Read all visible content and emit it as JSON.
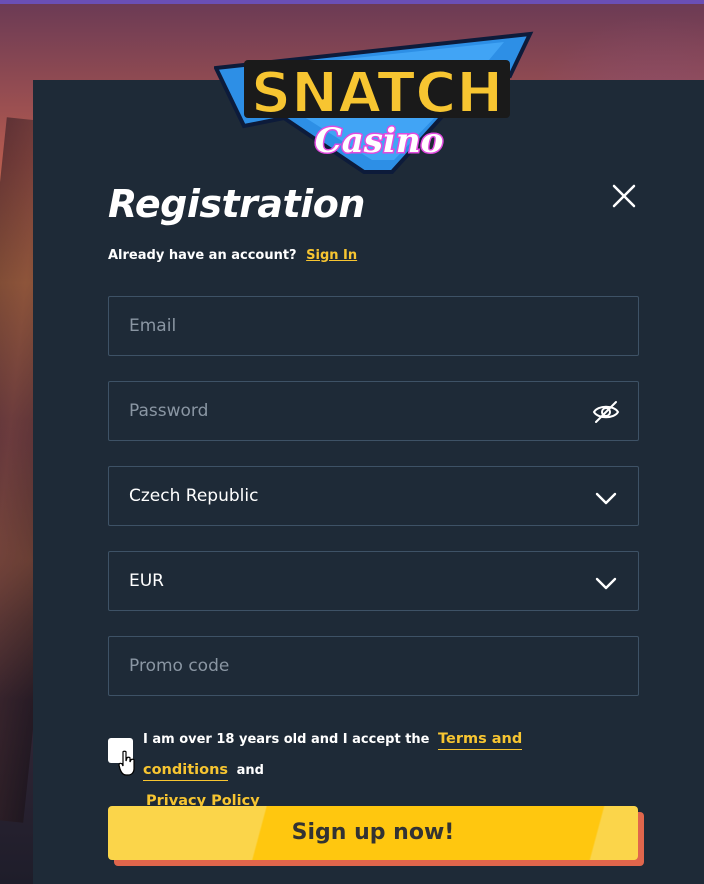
{
  "brand": {
    "logo_text_main": "SNATCH",
    "logo_text_sub": "Casino"
  },
  "modal": {
    "title": "Registration",
    "signin_prompt": "Already have an account?",
    "signin_link": "Sign In"
  },
  "form": {
    "email": {
      "placeholder": "Email",
      "value": ""
    },
    "password": {
      "placeholder": "Password",
      "value": ""
    },
    "country": {
      "selected": "Czech Republic"
    },
    "currency": {
      "selected": "EUR"
    },
    "promo": {
      "placeholder": "Promo code",
      "value": ""
    },
    "terms": {
      "prefix": "I am over 18 years old and I accept the",
      "terms_link": "Terms and conditions",
      "and": "and",
      "privacy_link": "Privacy Policy",
      "checked": false
    },
    "submit_label": "Sign up now!"
  },
  "icons": {
    "close": "close-icon",
    "password_toggle": "eye-off-icon",
    "dropdown": "chevron-down-icon"
  },
  "colors": {
    "panel_bg": "#1e2a37",
    "accent": "#f7c531",
    "button": "#ffc70f",
    "button_shadow": "#e0664c",
    "field_border": "#3e5266"
  }
}
